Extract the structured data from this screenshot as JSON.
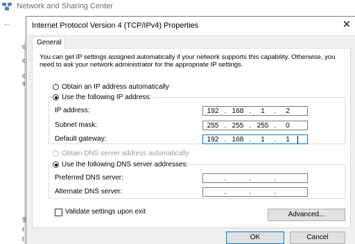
{
  "background_window": {
    "title": "Network and Sharing Center",
    "left_letters": [
      "c",
      "c",
      "c",
      "s",
      "S",
      "I",
      "I"
    ]
  },
  "dialog": {
    "title": "Internet Protocol Version 4 (TCP/IPv4) Properties",
    "tab": "General",
    "intro": "You can get IP settings assigned automatically if your network supports this capability. Otherwise, you need to ask your network administrator for the appropriate IP settings.",
    "ip": {
      "auto_label": "Obtain an IP address automatically",
      "manual_label": "Use the following IP address:",
      "selected": "manual",
      "fields": [
        {
          "label": "IP address:",
          "octets": [
            "192",
            "168",
            "1",
            "2"
          ]
        },
        {
          "label": "Subnet mask:",
          "octets": [
            "255",
            "255",
            "255",
            "0"
          ]
        },
        {
          "label": "Default gateway:",
          "octets": [
            "192",
            "168",
            "1",
            "1"
          ]
        }
      ]
    },
    "dns": {
      "auto_label": "Obtain DNS server address automatically",
      "manual_label": "Use the following DNS server addresses:",
      "selected": "manual",
      "fields": [
        {
          "label": "Preferred DNS server:",
          "octets": [
            "",
            "",
            "",
            ""
          ]
        },
        {
          "label": "Alternate DNS server:",
          "octets": [
            "",
            "",
            "",
            ""
          ]
        }
      ]
    },
    "validate_label": "Validate settings upon exit",
    "validate_checked": false,
    "advanced_button": "Advanced...",
    "ok_button": "OK",
    "cancel_button": "Cancel"
  },
  "colors": {
    "accent": "#0078d7",
    "dialog_background": "#f0f0f0"
  },
  "icons": {
    "background_app": "network-icon",
    "back": "back-arrow-icon",
    "close": "close-icon"
  }
}
